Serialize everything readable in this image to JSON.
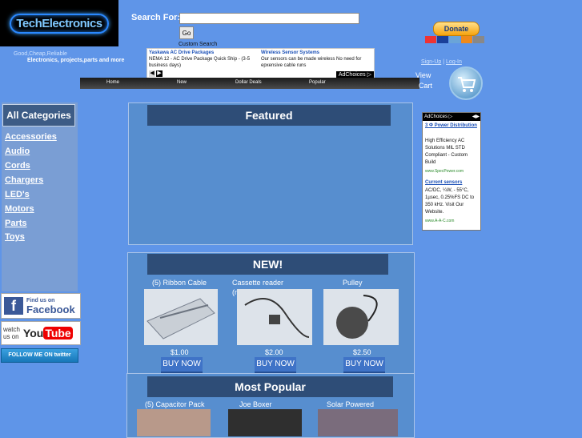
{
  "site": {
    "logo_text": "TechElectronics",
    "tagline": "Good,Cheap,Reliable",
    "subtagline": "Electronics, projects,parts and more"
  },
  "search": {
    "label": "Search For:",
    "value": "",
    "go_label": "Go",
    "custom_search": "Custom Search"
  },
  "top_ad": {
    "left_title": "Yaskawa AC Drive Packages",
    "left_body": "NEMA 12 - AC Drive Package Quick Ship - (3-5 business days)",
    "right_title": "Wireless Sensor Systems",
    "right_body": "Our sensors can be made wireless No need for epxensive cable runs",
    "adchoices": "AdChoices ▷"
  },
  "nav": {
    "items": [
      "Home",
      "New",
      "Dollar Deals",
      "Popular"
    ]
  },
  "donate": {
    "label": "Donate"
  },
  "account": {
    "signup": "Sign-Up",
    "separator": "|",
    "login": "Log-In"
  },
  "cart": {
    "line1": "View",
    "line2": "Cart"
  },
  "categories": {
    "title": "All Categories",
    "items": [
      "Accessories",
      "Audio",
      "Cords",
      "Chargers",
      "LED's",
      "Motors",
      "Parts",
      "Toys"
    ]
  },
  "social": {
    "fb_line1": "Find us on",
    "fb_line2": "Facebook",
    "yt_watch1": "watch",
    "yt_watch2": "us on",
    "yt_you": "You",
    "yt_tube": "Tube",
    "twitter": "FOLLOW ME ON twitter"
  },
  "featured": {
    "title": "Featured"
  },
  "new_section": {
    "title": "NEW!",
    "products": [
      {
        "name": "(5) Ribbon Cable",
        "price": "$1.00",
        "buy": "BUY NOW"
      },
      {
        "name": "Cassette reader (module)",
        "price": "$2.00",
        "buy": "BUY NOW"
      },
      {
        "name": "Pulley Motor",
        "price": "$2.50",
        "buy": "BUY NOW"
      }
    ]
  },
  "popular": {
    "title": "Most Popular",
    "products": [
      {
        "name": "(5) Capacitor Pack"
      },
      {
        "name": "Joe Boxer watch"
      },
      {
        "name": "Solar Powered Car"
      }
    ]
  },
  "right_ad": {
    "adchoices": "AdChoices ▷",
    "ad1_title": "3 Φ Power Distribution",
    "ad1_body": "High Efficiency AC Solutions MIL STD Compliant - Custom Build",
    "ad1_url": "www.SpecPower.com",
    "ad2_title": "Current sensors",
    "ad2_body": "AC/DC, ¼W, - 55°C, 1µsec, 0.25%FS DC to 350 kHz. Visit Our Website.",
    "ad2_url": "www.A-A-C.com"
  }
}
